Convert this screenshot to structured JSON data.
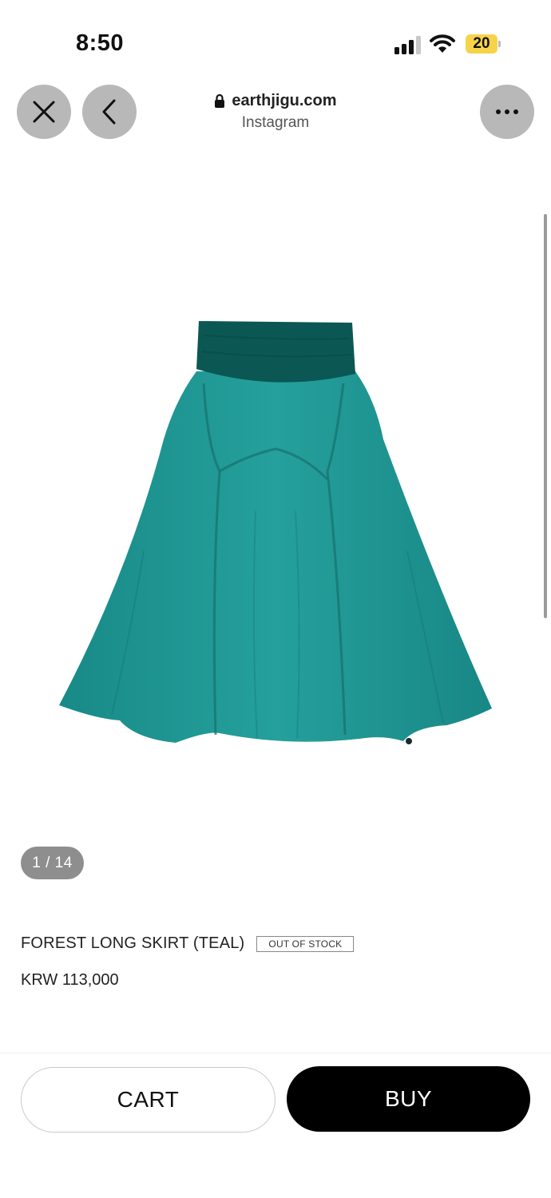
{
  "status_bar": {
    "time": "8:50",
    "battery_level": "20",
    "icons": [
      "cellular-signal-icon",
      "wifi-icon",
      "battery-icon"
    ]
  },
  "browser": {
    "domain": "earthjigu.com",
    "source_app": "Instagram",
    "icons": [
      "close-icon",
      "back-icon",
      "lock-icon",
      "more-icon"
    ]
  },
  "gallery": {
    "counter": "1 / 14"
  },
  "product": {
    "name": "FOREST LONG SKIRT (TEAL)",
    "stock_status": "OUT OF STOCK",
    "price": "KRW 113,000",
    "color": "#1e8f8c"
  },
  "actions": {
    "cart_label": "CART",
    "buy_label": "BUY"
  }
}
